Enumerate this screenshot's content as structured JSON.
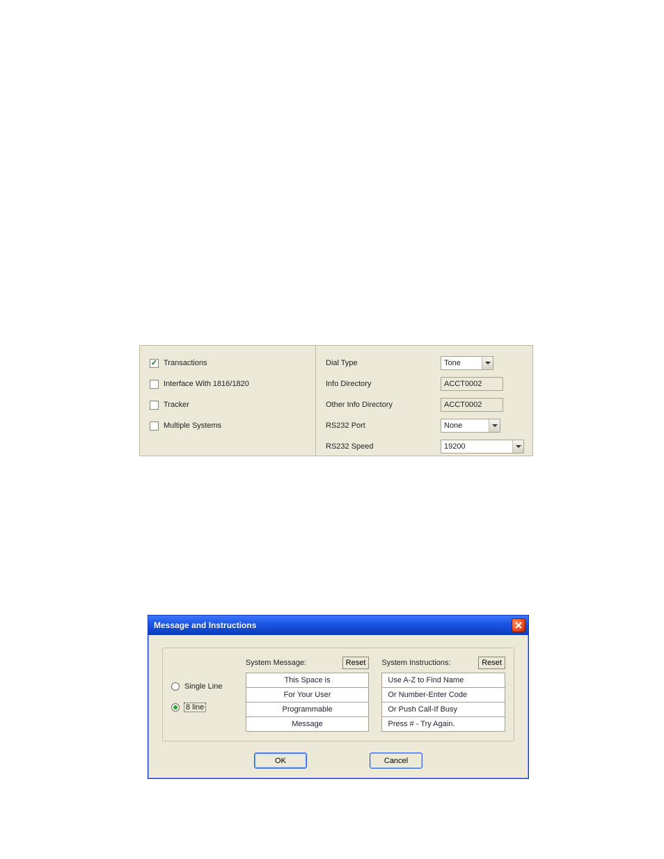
{
  "settings": {
    "checkboxes": {
      "transactions": {
        "label": "Transactions",
        "checked": true
      },
      "interface_1816_1820": {
        "label": "Interface With 1816/1820",
        "checked": false
      },
      "tracker": {
        "label": "Tracker",
        "checked": false
      },
      "multiple_systems": {
        "label": "Multiple Systems",
        "checked": false
      }
    },
    "fields": {
      "dial_type": {
        "label": "Dial Type",
        "value": "Tone"
      },
      "info_directory": {
        "label": "Info Directory",
        "value": "ACCT0002"
      },
      "other_info_directory": {
        "label": "Other Info Directory",
        "value": "ACCT0002"
      },
      "rs232_port": {
        "label": "RS232 Port",
        "value": "None"
      },
      "rs232_speed": {
        "label": "RS232 Speed",
        "value": "19200"
      }
    }
  },
  "dialog": {
    "title": "Message and Instructions",
    "radio": {
      "single_line": {
        "label": "Single Line",
        "selected": false
      },
      "eight_line": {
        "label": "8 line",
        "selected": true
      }
    },
    "system_message": {
      "header": "System Message:",
      "reset": "Reset",
      "lines": [
        "This Space is",
        "For Your User",
        "Programmable",
        "Message"
      ]
    },
    "system_instructions": {
      "header": "System Instructions:",
      "reset": "Reset",
      "lines": [
        "Use A-Z to Find Name",
        "Or Number-Enter Code",
        "Or Push Call-If Busy",
        "Press # - Try Again."
      ]
    },
    "buttons": {
      "ok": "OK",
      "cancel": "Cancel"
    }
  }
}
